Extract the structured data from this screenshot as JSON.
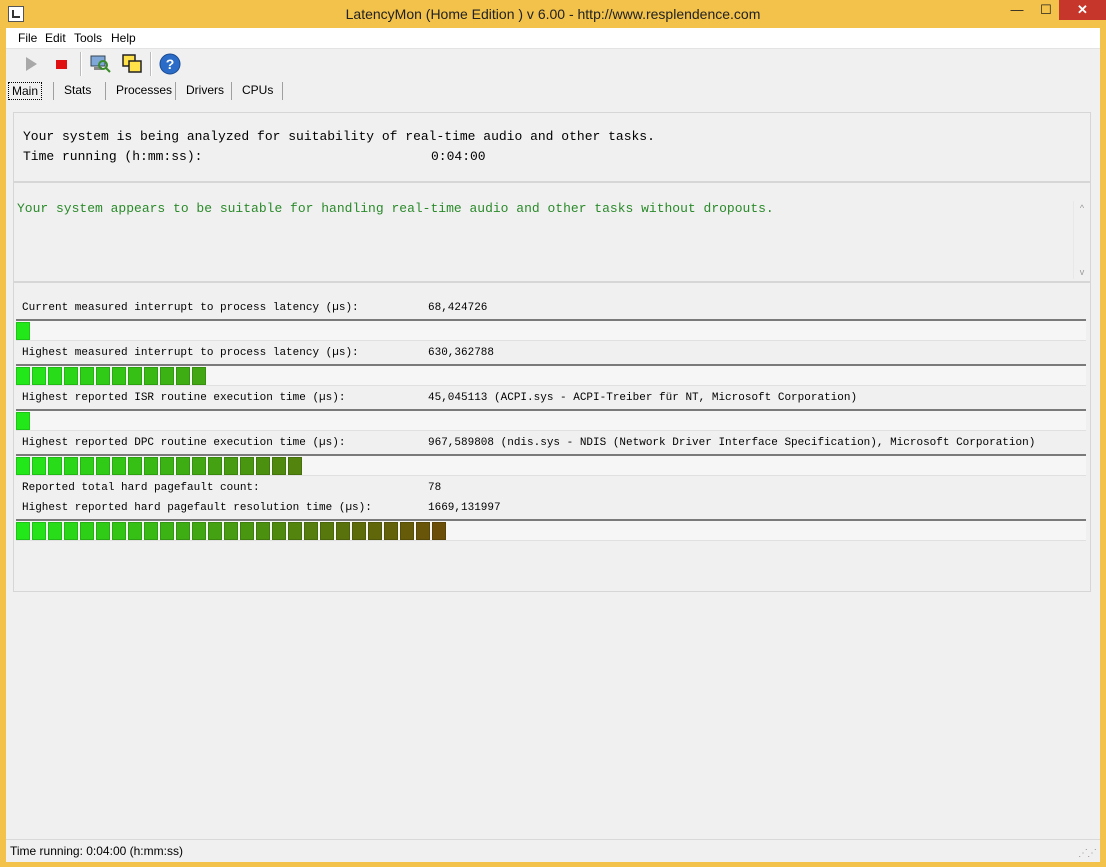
{
  "window": {
    "title": "LatencyMon  (Home Edition )  v 6.00 - http://www.resplendence.com",
    "minimize_glyph": "—",
    "maximize_glyph": "☐",
    "close_glyph": "✕"
  },
  "menu": [
    "File",
    "Edit",
    "Tools",
    "Help"
  ],
  "toolbar": {
    "buttons": [
      "play-icon",
      "stop-icon",
      "computer-search-icon",
      "windows-icon",
      "help-icon"
    ],
    "help_glyph": "?"
  },
  "tabs": [
    "Main",
    "Stats",
    "Processes",
    "Drivers",
    "CPUs"
  ],
  "main": {
    "analyzing_text": "Your system is being analyzed for suitability of real-time audio and other tasks.",
    "time_running_label": "Time running (h:mm:ss):",
    "time_running_value": "0:04:00",
    "verdict": "Your system appears to be suitable for handling real-time audio and other tasks without dropouts.",
    "verdict_color": "#2a8a2a",
    "scroll_up": "^",
    "scroll_down": "v"
  },
  "stats": {
    "current_interrupt_label": "Current measured interrupt to process latency (µs):",
    "current_interrupt_value": "68,424726",
    "highest_interrupt_label": "Highest measured interrupt to process latency (µs):",
    "highest_interrupt_value": "630,362788",
    "isr_label": "Highest reported ISR routine execution time (µs):",
    "isr_value": "45,045113  (ACPI.sys - ACPI-Treiber für NT, Microsoft Corporation)",
    "dpc_label": "Highest reported DPC routine execution time (µs):",
    "dpc_value": "967,589808  (ndis.sys - NDIS (Network Driver Interface Specification), Microsoft Corporation)",
    "pagefault_count_label": "Reported total hard pagefault count:",
    "pagefault_count_value": "78",
    "pagefault_time_label": "Highest reported hard pagefault resolution time (µs):",
    "pagefault_time_value": "1669,131997"
  },
  "bars": {
    "current_interrupt_segments": 1,
    "highest_interrupt_segments": 12,
    "isr_segments": 1,
    "dpc_segments": 18,
    "pagefault_segments": 27,
    "color_start": "#22e81a",
    "color_end": "#6b4f08"
  },
  "status": {
    "text": "Time running: 0:04:00  (h:mm:ss)"
  }
}
